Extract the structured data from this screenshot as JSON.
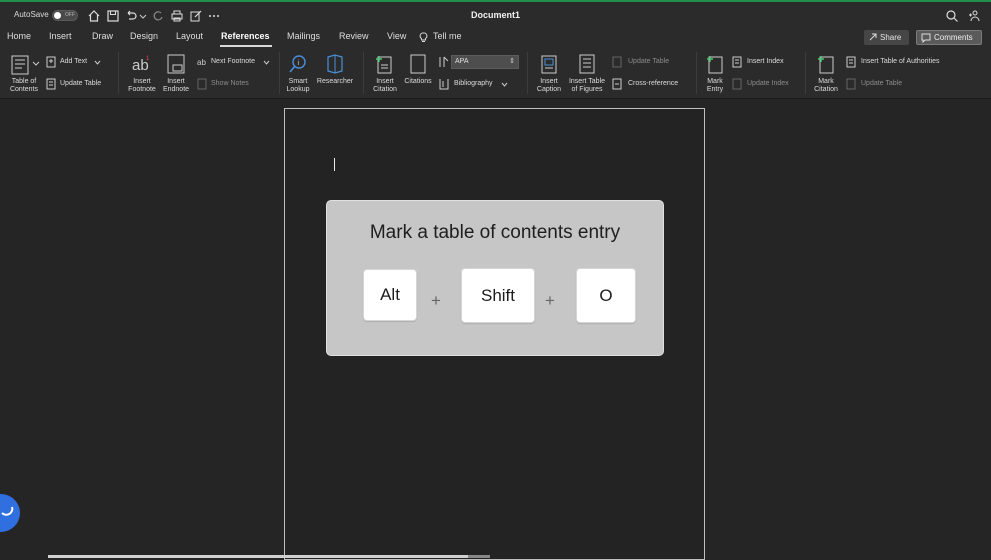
{
  "titlebar": {
    "autosave_label": "AutoSave",
    "autosave_state": "OFF",
    "document_title": "Document1"
  },
  "tabs": [
    {
      "label": "Home"
    },
    {
      "label": "Insert"
    },
    {
      "label": "Draw"
    },
    {
      "label": "Design"
    },
    {
      "label": "Layout"
    },
    {
      "label": "References"
    },
    {
      "label": "Mailings"
    },
    {
      "label": "Review"
    },
    {
      "label": "View"
    },
    {
      "label": "Tell me"
    }
  ],
  "active_tab": "References",
  "share": {
    "label": "Share"
  },
  "comments": {
    "label": "Comments"
  },
  "ribbon": {
    "toc": {
      "label_line1": "Table of",
      "label_line2": "Contents"
    },
    "add_text": "Add Text",
    "update_table_toc": "Update Table",
    "insert_footnote": {
      "line1": "Insert",
      "line2": "Footnote"
    },
    "insert_endnote": {
      "line1": "Insert",
      "line2": "Endnote"
    },
    "next_footnote": "Next Footnote",
    "show_notes": "Show Notes",
    "smart_lookup": {
      "line1": "Smart",
      "line2": "Lookup"
    },
    "researcher": "Researcher",
    "insert_citation": {
      "line1": "Insert",
      "line2": "Citation"
    },
    "citations": "Citations",
    "style_value": "APA",
    "bibliography": "Bibliography",
    "insert_caption": {
      "line1": "Insert",
      "line2": "Caption"
    },
    "insert_table_figures": {
      "line1": "Insert Table",
      "line2": "of Figures"
    },
    "update_table_captions": "Update Table",
    "cross_reference": "Cross-reference",
    "mark_entry": {
      "line1": "Mark",
      "line2": "Entry"
    },
    "insert_index": "Insert Index",
    "update_index": "Update Index",
    "mark_citation": {
      "line1": "Mark",
      "line2": "Citation"
    },
    "insert_table_authorities": "Insert Table of Authorities",
    "update_table_authorities": "Update Table"
  },
  "shortcut_overlay": {
    "title": "Mark a table of contents entry",
    "keys": [
      "Alt",
      "Shift",
      "O"
    ],
    "separator": "+"
  },
  "colors": {
    "background": "#252525",
    "ribbon": "#2b2b2b",
    "overlay": "#c6c6c6",
    "assistant": "#2f6fe0"
  }
}
